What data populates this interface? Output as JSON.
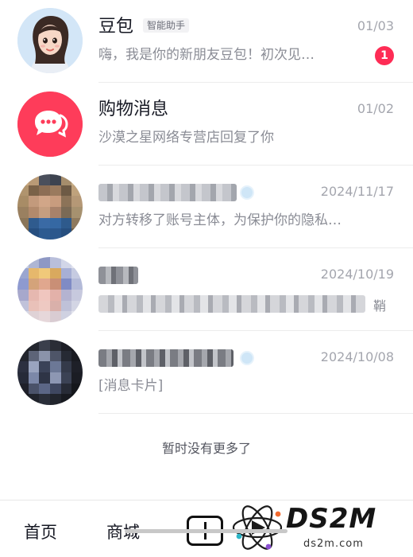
{
  "conversations": [
    {
      "name": "豆包",
      "tag": "智能助手",
      "date": "01/03",
      "preview": "嗨，我是你的新朋友豆包！初次见…",
      "unread": "1",
      "avatar_icon": "cartoon-girl-avatar"
    },
    {
      "name": "购物消息",
      "date": "01/02",
      "preview": "沙漠之星网络专营店回复了你",
      "avatar_icon": "chat-bubble-icon",
      "avatar_color": "#fe3c5a"
    },
    {
      "name_obscured": true,
      "verified": true,
      "date": "2024/11/17",
      "preview": "对方转移了账号主体，为保护你的隐私…",
      "avatar_icon": "pixelated-photo"
    },
    {
      "name_obscured": true,
      "date": "2024/10/19",
      "preview_obscured": true,
      "preview_tail": "鞘",
      "avatar_icon": "pixelated-photo"
    },
    {
      "name_obscured": true,
      "verified": true,
      "date": "2024/10/08",
      "preview": "[消息卡片]",
      "avatar_icon": "pixelated-photo"
    }
  ],
  "end_note": "暂时没有更多了",
  "bottom_nav": {
    "home": "首页",
    "mall": "商城",
    "create_icon": "plus-icon"
  },
  "watermark": {
    "brand": "DS2M",
    "url": "ds2m.com"
  },
  "colors": {
    "badge": "#fe2c55",
    "accent": "#fe3c5a"
  }
}
